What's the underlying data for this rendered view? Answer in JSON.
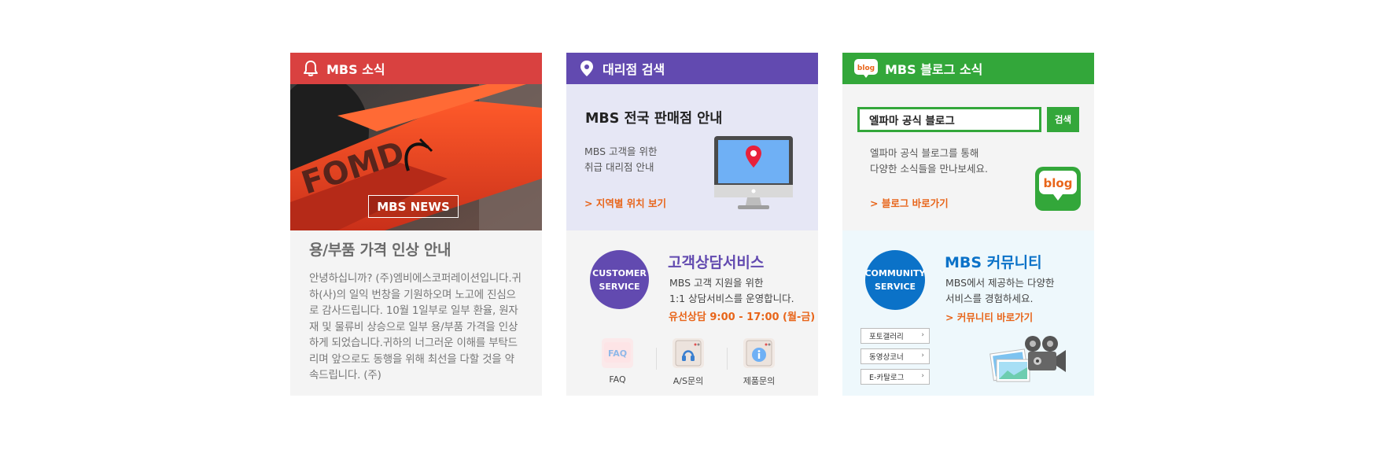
{
  "news": {
    "header": "MBS 소식",
    "tag": "MBS NEWS",
    "title": "용/부품 가격 인상 안내",
    "body": "안녕하십니까? (주)엠비에스코퍼레이션입니다.귀하(사)의 일익 번창을 기원하오며 노고에 진심으로 감사드립니다. 10월 1일부로 일부 환율, 원자재 및 물류비 상승으로 일부 용/부품 가격을 인상하게 되었습니다.귀하의 너그러운 이해를 부탁드리며 앞으로도 동행을 위해 최선을 다할 것을 약속드립니다. (주)"
  },
  "dealer": {
    "header": "대리점 검색",
    "title": "MBS 전국 판매점 안내",
    "desc_line1": "MBS 고객을 위한",
    "desc_line2": "취급 대리점 안내",
    "link": "> 지역별 위치 보기"
  },
  "customer_service": {
    "circle_line1": "CUSTOMER",
    "circle_line2": "SERVICE",
    "title": "고객상담서비스",
    "desc_line1": "MBS 고객 지원을 위한",
    "desc_line2": "1:1 상담서비스를 운영합니다.",
    "hours": "유선상담 9:00 - 17:00 (월-금)",
    "items": [
      {
        "label": "FAQ",
        "icon_text": "FAQ"
      },
      {
        "label": "A/S문의"
      },
      {
        "label": "제품문의"
      }
    ]
  },
  "blog": {
    "header": "MBS 블로그 소식",
    "header_icon_text": "blog",
    "search_value": "엘파마 공식 블로그",
    "search_button": "검색",
    "desc_line1": "엘파마 공식 블로그를 통해",
    "desc_line2": "다양한 소식들을 만나보세요.",
    "link": "> 블로그 바로가기",
    "logo_text": "blog"
  },
  "community": {
    "circle_line1": "COMMUNITY",
    "circle_line2": "SERVICE",
    "title": "MBS 커뮤니티",
    "desc_line1": "MBS에서 제공하는 다양한",
    "desc_line2": "서비스를 경험하세요.",
    "link": "> 커뮤니티 바로가기",
    "buttons": [
      "포토갤러리",
      "동영상코너",
      "E-카탈로그"
    ],
    "arrow": "›"
  },
  "colors": {
    "red": "#d94140",
    "purple": "#624ab0",
    "green": "#33a73a",
    "blue": "#0b72c8",
    "orange": "#e8651a"
  }
}
